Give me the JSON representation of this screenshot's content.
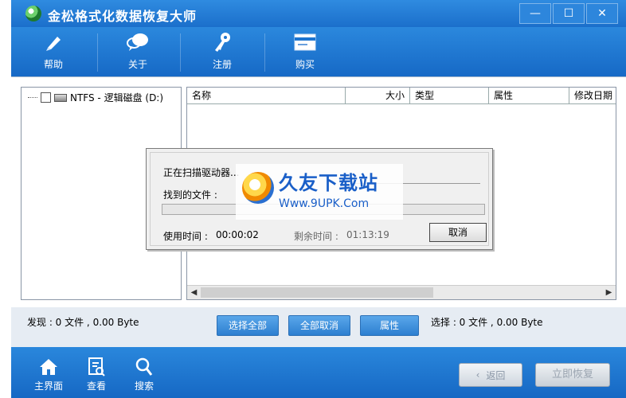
{
  "app": {
    "title": "金松格式化数据恢复大师"
  },
  "window_controls": {
    "minimize": "—",
    "maximize": "☐",
    "close": "✕"
  },
  "toolbar": {
    "items": [
      {
        "label": "帮助",
        "icon": "pen-icon"
      },
      {
        "label": "关于",
        "icon": "chat-icon"
      },
      {
        "label": "注册",
        "icon": "key-icon"
      },
      {
        "label": "购买",
        "icon": "card-icon"
      }
    ]
  },
  "tree": {
    "items": [
      {
        "label": "NTFS - 逻辑磁盘 (D:)"
      }
    ]
  },
  "list": {
    "columns": [
      "名称",
      "大小",
      "类型",
      "属性",
      "修改日期"
    ],
    "rows": []
  },
  "dialog": {
    "scanning": "正在扫描驱动器...",
    "found_files": "找到的文件 :",
    "elapsed_label": "使用时间 :",
    "elapsed_value": "00:00:02",
    "remaining_label": "剩余时间 :",
    "remaining_value": "01:13:19",
    "cancel": "取消",
    "progress": 0.0
  },
  "watermark": {
    "title": "久友下载站",
    "url": "Www.9UPK.Com"
  },
  "status": {
    "found": "发现 : 0 文件 , 0.00 Byte",
    "selected": "选择 : 0 文件 , 0.00 Byte",
    "select_all": "选择全部",
    "cancel_all": "全部取消",
    "properties": "属性"
  },
  "bottom": {
    "nav": [
      {
        "label": "主界面",
        "icon": "home-icon"
      },
      {
        "label": "查看",
        "icon": "view-icon"
      },
      {
        "label": "搜索",
        "icon": "search-icon"
      }
    ],
    "back": "返回",
    "restore": "立即恢复"
  }
}
